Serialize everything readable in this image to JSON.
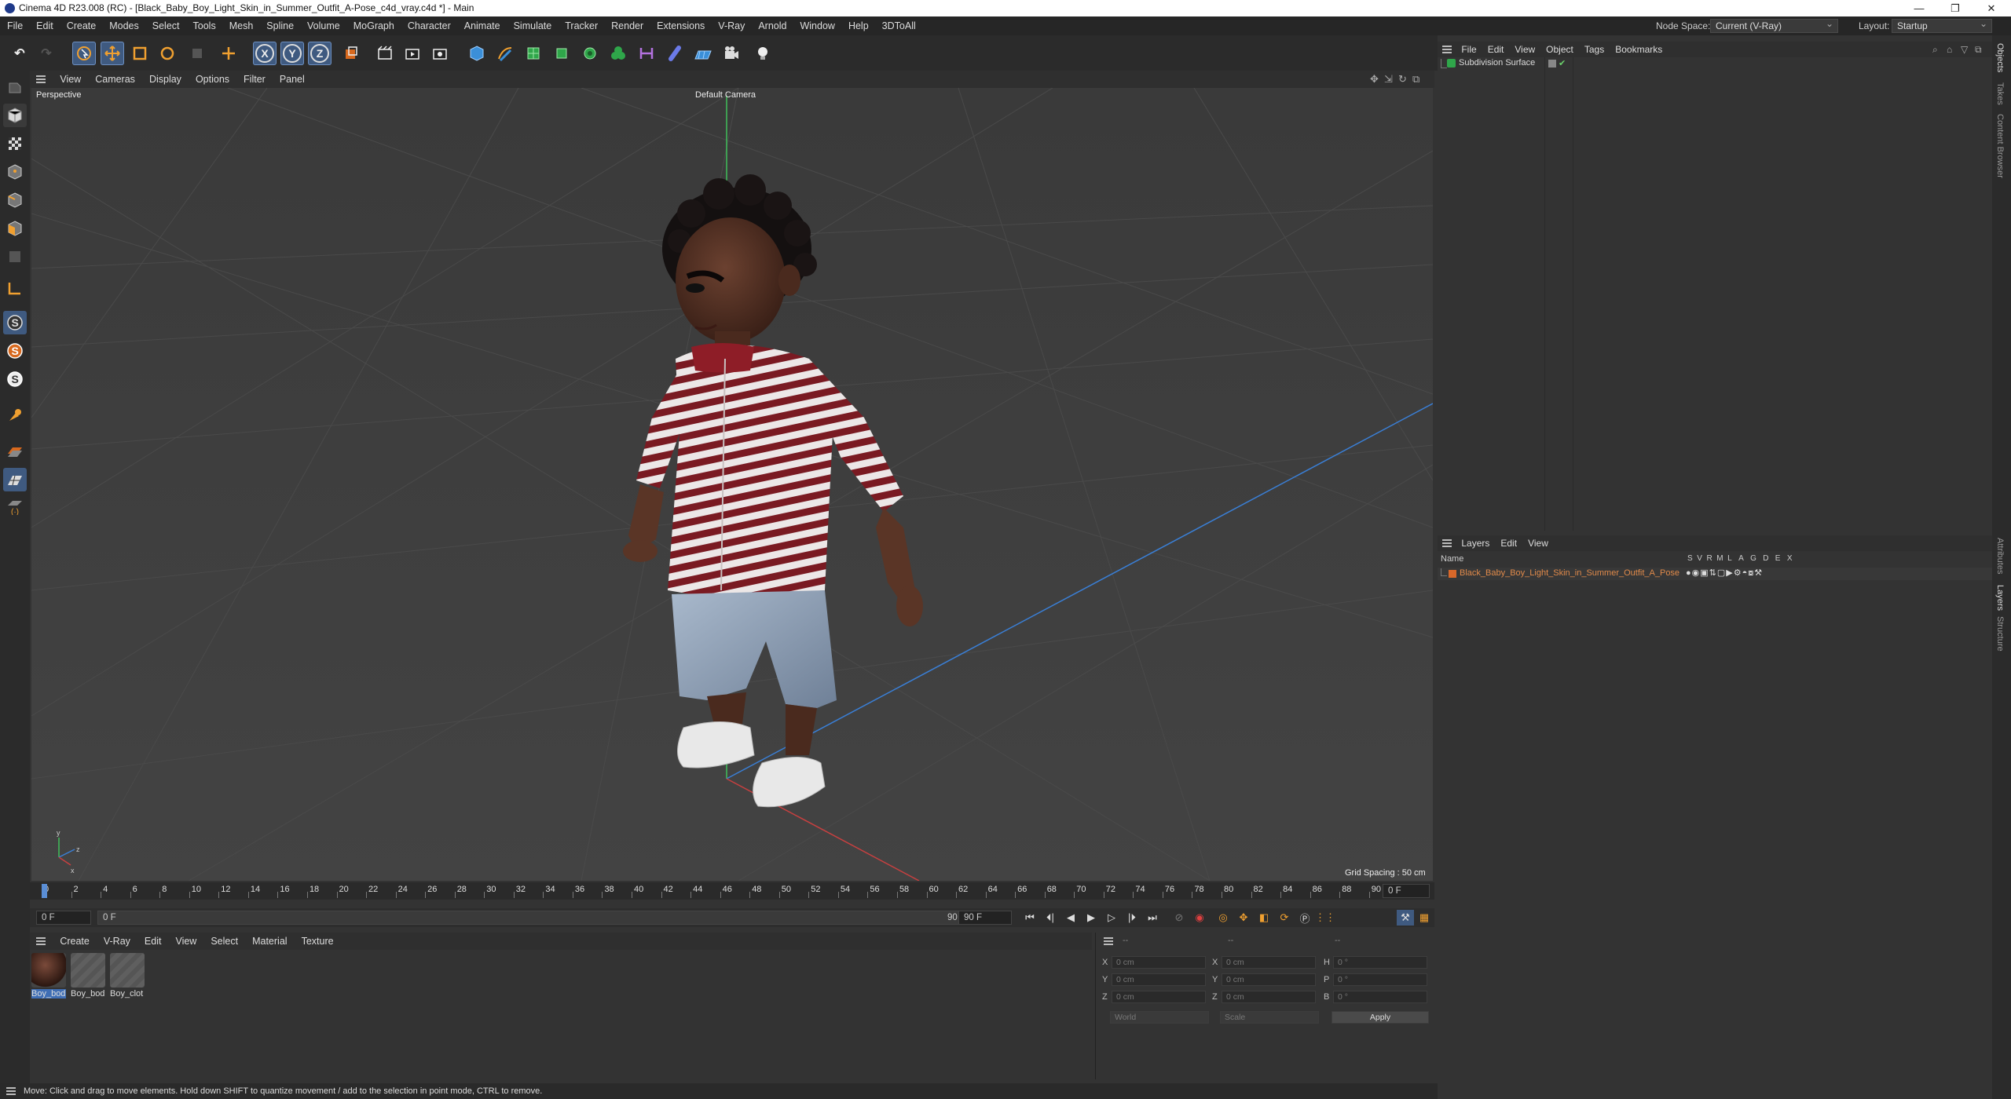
{
  "titlebar": {
    "title": "Cinema 4D R23.008 (RC) - [Black_Baby_Boy_Light_Skin_in_Summer_Outfit_A-Pose_c4d_vray.c4d *] - Main"
  },
  "menu": [
    "File",
    "Edit",
    "Create",
    "Modes",
    "Select",
    "Tools",
    "Mesh",
    "Spline",
    "Volume",
    "MoGraph",
    "Character",
    "Animate",
    "Simulate",
    "Tracker",
    "Render",
    "Extensions",
    "V-Ray",
    "Arnold",
    "Window",
    "Help",
    "3DToAll"
  ],
  "node_space": {
    "label": "Node Space:",
    "value": "Current (V-Ray)"
  },
  "layout": {
    "label": "Layout:",
    "value": "Startup"
  },
  "toolbar": {
    "axis_x": "X",
    "axis_y": "Y",
    "axis_z": "Z"
  },
  "viewport": {
    "menu": [
      "View",
      "Cameras",
      "Display",
      "Options",
      "Filter",
      "Panel"
    ],
    "name": "Perspective",
    "camera": "Default Camera",
    "grid_spacing": "Grid Spacing : 50 cm",
    "axis_x": "x",
    "axis_y": "y",
    "axis_z": "z"
  },
  "timeline": {
    "ticks": [
      "0",
      "2",
      "4",
      "6",
      "8",
      "10",
      "12",
      "14",
      "16",
      "18",
      "20",
      "22",
      "24",
      "26",
      "28",
      "30",
      "32",
      "34",
      "36",
      "38",
      "40",
      "42",
      "44",
      "46",
      "48",
      "50",
      "52",
      "54",
      "56",
      "58",
      "60",
      "62",
      "64",
      "66",
      "68",
      "70",
      "72",
      "74",
      "76",
      "78",
      "80",
      "82",
      "84",
      "86",
      "88",
      "90"
    ],
    "current": "0 F"
  },
  "transport": {
    "start": "0 F",
    "start2": "0 F",
    "end": "90 F",
    "end2": "90 F"
  },
  "materials": {
    "menu": [
      "Create",
      "V-Ray",
      "Edit",
      "View",
      "Select",
      "Material",
      "Texture"
    ],
    "items": [
      {
        "label": "Boy_bod"
      },
      {
        "label": "Boy_bod"
      },
      {
        "label": "Boy_clot"
      }
    ]
  },
  "coords": {
    "header1": "--",
    "header2": "--",
    "header3": "--",
    "x_label": "X",
    "y_label": "Y",
    "z_label": "Z",
    "x2_label": "X",
    "y2_label": "Y",
    "z2_label": "Z",
    "h_label": "H",
    "p_label": "P",
    "b_label": "B",
    "x": "0 cm",
    "y": "0 cm",
    "z": "0 cm",
    "x2": "0 cm",
    "y2": "0 cm",
    "z2": "0 cm",
    "h": "0 °",
    "p": "0 °",
    "b": "0 °",
    "space": "World",
    "mode": "Scale",
    "apply": "Apply"
  },
  "objects": {
    "menu": [
      "File",
      "Edit",
      "View",
      "Object",
      "Tags",
      "Bookmarks"
    ],
    "item": "Subdivision Surface"
  },
  "layers": {
    "menu": [
      "Layers",
      "Edit",
      "View"
    ],
    "col_name": "Name",
    "flags": [
      "S",
      "V",
      "R",
      "M",
      "L",
      "A",
      "G",
      "D",
      "E",
      "X"
    ],
    "item": "Black_Baby_Boy_Light_Skin_in_Summer_Outfit_A_Pose",
    "item_color": "#d9682a"
  },
  "side_tabs": [
    "Objects",
    "Takes",
    "Content Browser"
  ],
  "side_tabs2": [
    "Attributes",
    "Layers",
    "Structure"
  ],
  "status": "Move: Click and drag to move elements. Hold down SHIFT to quantize movement / add to the selection in point mode, CTRL to remove."
}
